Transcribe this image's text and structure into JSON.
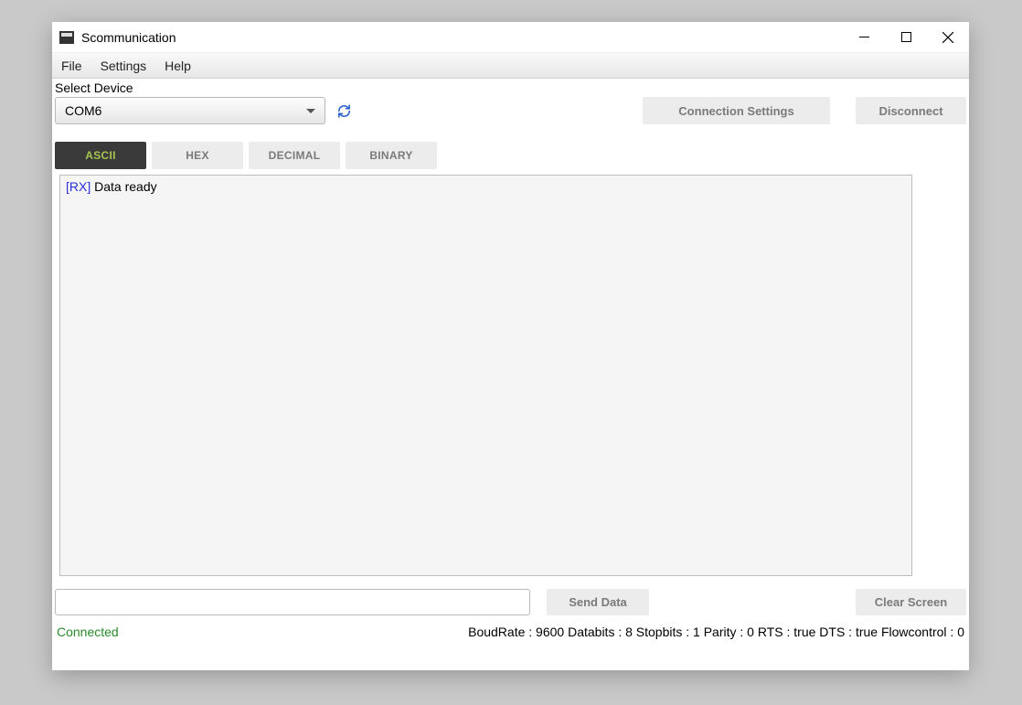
{
  "window": {
    "title": "Scommunication"
  },
  "menubar": {
    "items": [
      "File",
      "Settings",
      "Help"
    ]
  },
  "device": {
    "label": "Select Device",
    "selected": "COM6"
  },
  "buttons": {
    "connection_settings": "Connection Settings",
    "disconnect": "Disconnect",
    "send_data": "Send Data",
    "clear_screen": "Clear Screen"
  },
  "tabs": {
    "items": [
      "ASCII",
      "HEX",
      "DECIMAL",
      "BINARY"
    ],
    "active_index": 0
  },
  "output": {
    "lines": [
      {
        "tag": "[RX]",
        "text": " Data ready"
      }
    ]
  },
  "input": {
    "value": ""
  },
  "status": {
    "connection": "Connected",
    "info": "BoudRate : 9600 Databits : 8 Stopbits : 1 Parity : 0 RTS : true DTS : true Flowcontrol : 0"
  }
}
